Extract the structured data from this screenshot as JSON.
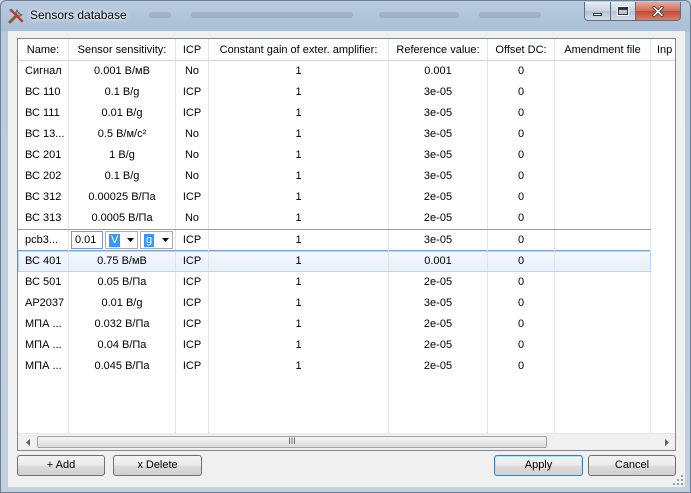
{
  "window": {
    "title": "Sensors database"
  },
  "grid": {
    "columns": [
      "Name:",
      "Sensor sensitivity:",
      "ICP",
      "Constant gain of exter. amplifier:",
      "Reference value:",
      "Offset DC:",
      "Amendment file",
      "Inp"
    ],
    "rows_before": [
      {
        "name": "Сигнал",
        "sensitivity": "0.001 В/мВ",
        "icp": "No",
        "gain": "1",
        "ref": "0.001",
        "offset": "0"
      },
      {
        "name": "ВС 110",
        "sensitivity": "0.1 В/g",
        "icp": "ICP",
        "gain": "1",
        "ref": "3e-05",
        "offset": "0"
      },
      {
        "name": "ВС 111",
        "sensitivity": "0.01 В/g",
        "icp": "ICP",
        "gain": "1",
        "ref": "3e-05",
        "offset": "0"
      },
      {
        "name": "ВС 13...",
        "sensitivity": "0.5 В/м/с²",
        "icp": "No",
        "gain": "1",
        "ref": "3e-05",
        "offset": "0"
      },
      {
        "name": "ВС 201",
        "sensitivity": "1 В/g",
        "icp": "No",
        "gain": "1",
        "ref": "3e-05",
        "offset": "0"
      },
      {
        "name": "ВС 202",
        "sensitivity": "0.1 В/g",
        "icp": "No",
        "gain": "1",
        "ref": "3e-05",
        "offset": "0"
      },
      {
        "name": "ВС 312",
        "sensitivity": "0.00025 В/Па",
        "icp": "ICP",
        "gain": "1",
        "ref": "2e-05",
        "offset": "0"
      },
      {
        "name": "ВС 313",
        "sensitivity": "0.0005 В/Па",
        "icp": "No",
        "gain": "1",
        "ref": "2e-05",
        "offset": "0"
      }
    ],
    "editing_row": {
      "name": "pcb3...",
      "value": "0.01",
      "unit1": "V",
      "unit2": "g",
      "icp": "ICP",
      "gain": "1",
      "ref": "3e-05",
      "offset": "0"
    },
    "selected_row": {
      "name": "ВС 401",
      "sensitivity": "0.75 В/мВ",
      "icp": "ICP",
      "gain": "1",
      "ref": "0.001",
      "offset": "0"
    },
    "rows_after": [
      {
        "name": "ВС 501",
        "sensitivity": "0.05 В/Па",
        "icp": "ICP",
        "gain": "1",
        "ref": "2e-05",
        "offset": "0"
      },
      {
        "name": "AP2037",
        "sensitivity": "0.01 В/g",
        "icp": "ICP",
        "gain": "1",
        "ref": "3e-05",
        "offset": "0"
      },
      {
        "name": "МПА ...",
        "sensitivity": "0.032 В/Па",
        "icp": "ICP",
        "gain": "1",
        "ref": "2e-05",
        "offset": "0"
      },
      {
        "name": "МПА ...",
        "sensitivity": "0.04 В/Па",
        "icp": "ICP",
        "gain": "1",
        "ref": "2e-05",
        "offset": "0"
      },
      {
        "name": "МПА ...",
        "sensitivity": "0.045 В/Па",
        "icp": "ICP",
        "gain": "1",
        "ref": "2e-05",
        "offset": "0"
      }
    ],
    "scroll_thumb_label": "III"
  },
  "buttons": {
    "add": "+ Add",
    "delete": "x Delete",
    "apply": "Apply",
    "cancel": "Cancel"
  },
  "colors": {
    "selection": "#e6f0fa",
    "edit_highlight": "#3399ff",
    "close_button": "#c24a33"
  }
}
